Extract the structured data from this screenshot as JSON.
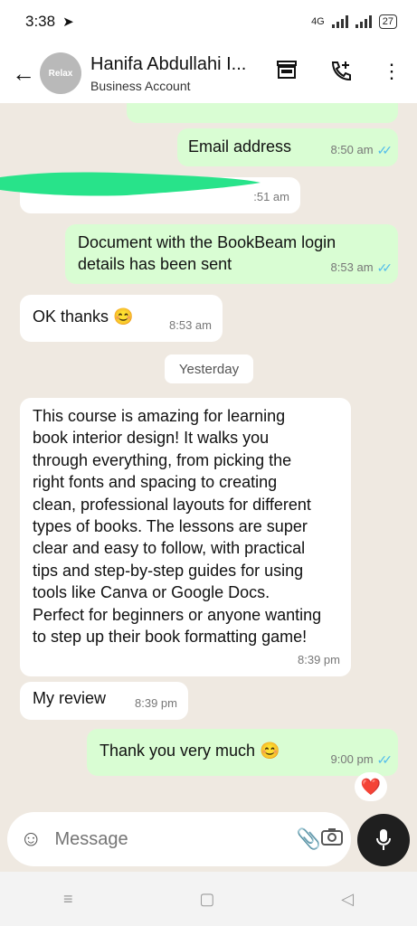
{
  "status_bar": {
    "time": "3:38",
    "network": "4G",
    "battery": "27"
  },
  "header": {
    "avatar_text_top": "Relax",
    "title": "Hanifa Abdullahi I...",
    "subtitle": "Business Account",
    "icons": [
      "back-arrow-icon",
      "store-icon",
      "add-call-icon",
      "more-icon"
    ]
  },
  "messages": [
    {
      "dir": "out",
      "text": "Email address",
      "time": "8:50 am",
      "ticks": "✓✓"
    },
    {
      "dir": "in",
      "text": "",
      "time": ":51 am"
    },
    {
      "dir": "out",
      "text": "Document with the BookBeam login details has been sent",
      "time": "8:53 am",
      "ticks": "✓✓"
    },
    {
      "dir": "in",
      "text": "OK thanks 😊",
      "time": "8:53 am"
    },
    {
      "dir": "in",
      "text": "This course is amazing for learning book interior design! It walks you through everything, from picking the right fonts and spacing to creating clean, professional layouts for different types of books. The lessons are super clear and easy to follow, with practical tips and step-by-step guides for using tools like Canva or Google Docs. Perfect for beginners or anyone wanting to step up their book formatting game!",
      "time": "8:39 pm"
    },
    {
      "dir": "in",
      "text": "My review",
      "time": "8:39 pm"
    },
    {
      "dir": "out",
      "text": "Thank you very much 😊",
      "time": "9:00 pm",
      "ticks": "✓✓"
    }
  ],
  "date_separator": "Yesterday",
  "reaction": "❤️",
  "composer": {
    "placeholder": "Message"
  },
  "colors": {
    "outgoing": "#d9fdd3",
    "incoming": "#ffffff",
    "background": "#efe9e1",
    "read_ticks": "#53bdeb"
  }
}
